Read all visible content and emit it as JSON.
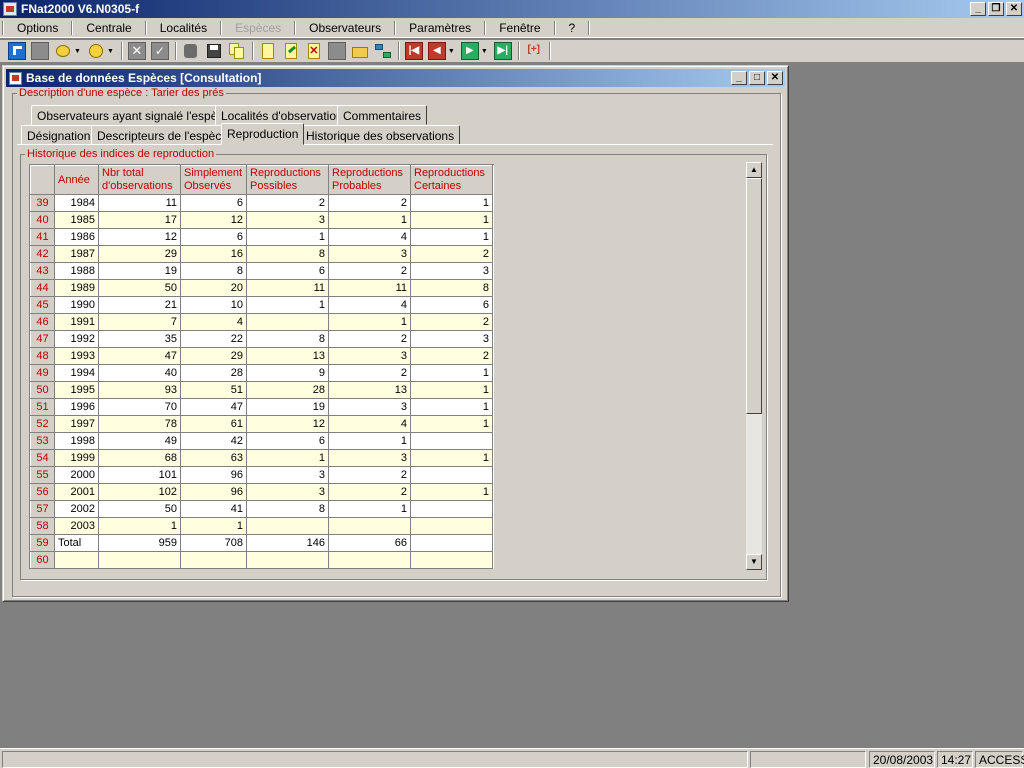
{
  "app": {
    "title": "FNat2000 V6.N0305-f"
  },
  "menu": [
    "Options",
    "Centrale",
    "Localités",
    "Espèces",
    "Observateurs",
    "Paramètres",
    "Fenêtre",
    "?"
  ],
  "menu_disabled": "Espèces",
  "child": {
    "title": "Base de données Espèces [Consultation]",
    "group_label": "Description d'une espèce : Tarier des prés",
    "tabs_row1": [
      "Observateurs ayant signalé l'espèce",
      "Localités d'observation",
      "Commentaires"
    ],
    "tabs_row2": [
      "Désignation",
      "Descripteurs de l'espèce",
      "Reproduction",
      "Historique des observations"
    ],
    "active_tab": "Reproduction",
    "inner_group_label": "Historique des indices de reproduction"
  },
  "grid": {
    "columns": [
      "Année",
      "Nbr total d'observations",
      "Simplement Observés",
      "Reproductions Possibles",
      "Reproductions Probables",
      "Reproductions Certaines"
    ],
    "rows": [
      {
        "n": "39",
        "cells": [
          "1984",
          "11",
          "6",
          "2",
          "2",
          "1"
        ]
      },
      {
        "n": "40",
        "cells": [
          "1985",
          "17",
          "12",
          "3",
          "1",
          "1"
        ]
      },
      {
        "n": "41",
        "cells": [
          "1986",
          "12",
          "6",
          "1",
          "4",
          "1"
        ]
      },
      {
        "n": "42",
        "cells": [
          "1987",
          "29",
          "16",
          "8",
          "3",
          "2"
        ]
      },
      {
        "n": "43",
        "cells": [
          "1988",
          "19",
          "8",
          "6",
          "2",
          "3"
        ]
      },
      {
        "n": "44",
        "cells": [
          "1989",
          "50",
          "20",
          "11",
          "11",
          "8"
        ]
      },
      {
        "n": "45",
        "cells": [
          "1990",
          "21",
          "10",
          "1",
          "4",
          "6"
        ]
      },
      {
        "n": "46",
        "cells": [
          "1991",
          "7",
          "4",
          "",
          "1",
          "2"
        ]
      },
      {
        "n": "47",
        "cells": [
          "1992",
          "35",
          "22",
          "8",
          "2",
          "3"
        ]
      },
      {
        "n": "48",
        "cells": [
          "1993",
          "47",
          "29",
          "13",
          "3",
          "2"
        ]
      },
      {
        "n": "49",
        "cells": [
          "1994",
          "40",
          "28",
          "9",
          "2",
          "1"
        ]
      },
      {
        "n": "50",
        "cells": [
          "1995",
          "93",
          "51",
          "28",
          "13",
          "1"
        ]
      },
      {
        "n": "51",
        "cells": [
          "1996",
          "70",
          "47",
          "19",
          "3",
          "1"
        ]
      },
      {
        "n": "52",
        "cells": [
          "1997",
          "78",
          "61",
          "12",
          "4",
          "1"
        ]
      },
      {
        "n": "53",
        "cells": [
          "1998",
          "49",
          "42",
          "6",
          "1",
          ""
        ]
      },
      {
        "n": "54",
        "cells": [
          "1999",
          "68",
          "63",
          "1",
          "3",
          "1"
        ]
      },
      {
        "n": "55",
        "cells": [
          "2000",
          "101",
          "96",
          "3",
          "2",
          ""
        ]
      },
      {
        "n": "56",
        "cells": [
          "2001",
          "102",
          "96",
          "3",
          "2",
          "1"
        ]
      },
      {
        "n": "57",
        "cells": [
          "2002",
          "50",
          "41",
          "8",
          "1",
          ""
        ]
      },
      {
        "n": "58",
        "cells": [
          "2003",
          "1",
          "1",
          "",
          "",
          ""
        ]
      },
      {
        "n": "59",
        "cells": [
          "Total",
          "959",
          "708",
          "146",
          "66",
          ""
        ]
      },
      {
        "n": "60",
        "cells": [
          "",
          "",
          "",
          "",
          "",
          ""
        ]
      }
    ]
  },
  "status": {
    "date": "20/08/2003",
    "time": "14:27",
    "mode": "ACCESS"
  },
  "colors": {
    "titlebar": "#0a246a",
    "header_text": "#c00000",
    "alt_row": "#ffffe0",
    "face": "#d4d0c8"
  }
}
